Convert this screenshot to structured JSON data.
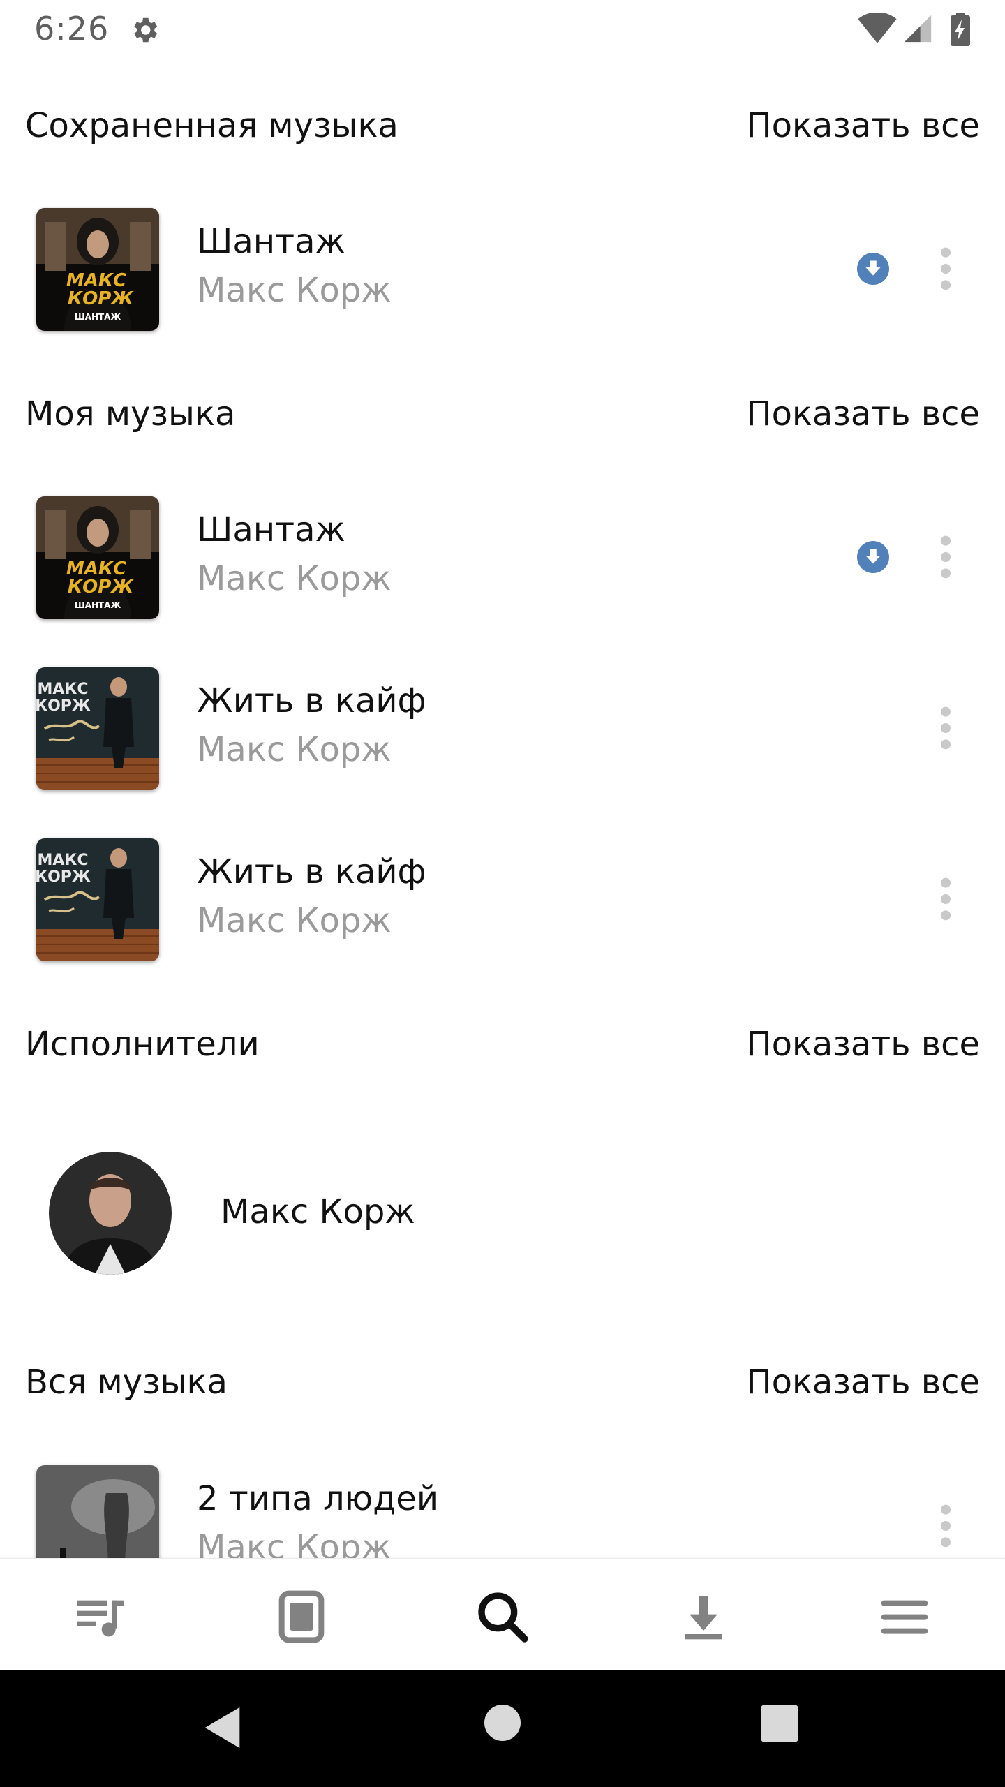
{
  "status_bar": {
    "time": "6:26"
  },
  "sections": {
    "saved": {
      "title": "Сохраненная музыка",
      "show_all": "Показать все"
    },
    "my_music": {
      "title": "Моя музыка",
      "show_all": "Показать все"
    },
    "artists": {
      "title": "Исполнители",
      "show_all": "Показать все"
    },
    "all_music": {
      "title": "Вся музыка",
      "show_all": "Показать все"
    }
  },
  "tracks": {
    "saved_1": {
      "title": "Шантаж",
      "artist": "Макс Корж",
      "downloaded": true
    },
    "my_1": {
      "title": "Шантаж",
      "artist": "Макс Корж",
      "downloaded": true
    },
    "my_2": {
      "title": "Жить в кайф",
      "artist": "Макс Корж",
      "downloaded": false
    },
    "my_3": {
      "title": "Жить в кайф",
      "artist": "Макс Корж",
      "downloaded": false
    },
    "all_1": {
      "title": "2 типа людей",
      "artist": "Макс Корж",
      "downloaded": false
    }
  },
  "covers": {
    "shantazh": {
      "line1": "МАКС",
      "line2": "КОРЖ",
      "caption": "ШАНТАЖ"
    },
    "zhit": {
      "line1": "МАКС",
      "line2": "КОРЖ"
    }
  },
  "artist": {
    "name": "Макс Корж"
  },
  "bottom_nav": [
    "playlist-icon",
    "library-icon",
    "search-icon",
    "download-icon",
    "menu-icon"
  ],
  "colors": {
    "accent": "#5181b8",
    "secondary_text": "#9a9a9a",
    "icon_gray": "#828282"
  }
}
